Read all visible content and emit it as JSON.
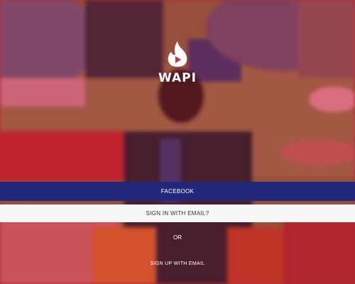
{
  "app": {
    "logo_text": "WAPI",
    "logo_icon": "flame-play-icon"
  },
  "buttons": {
    "facebook_label": "FACEBOOK",
    "signin_email_label": "SIGN IN WITH EMAIL?",
    "or_label": "OR",
    "signup_email_label": "SIGN UP WITH EMAIL"
  },
  "colors": {
    "facebook_bar": "#23297a",
    "signin_bar": "#f7f7f7",
    "overlay_tint": "#d6263e"
  }
}
